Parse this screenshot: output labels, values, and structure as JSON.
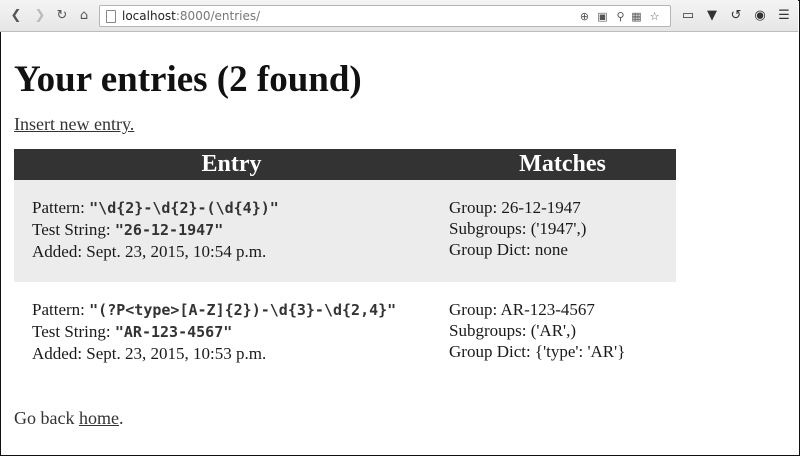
{
  "browser": {
    "url_host": "localhost",
    "url_rest": ":8000/entries/"
  },
  "page": {
    "title": "Your entries (2 found)",
    "insert_link": "Insert new entry.",
    "table_headers": {
      "entry": "Entry",
      "matches": "Matches"
    },
    "entries": [
      {
        "pattern_label": "Pattern: ",
        "pattern": "\"\\d{2}-\\d{2}-(\\d{4})\"",
        "test_label": "Test String: ",
        "test_string": "\"26-12-1947\"",
        "added": "Added: Sept. 23, 2015, 10:54 p.m.",
        "group": "Group: 26-12-1947",
        "subgroups": "Subgroups: ('1947',)",
        "group_dict": "Group Dict: none"
      },
      {
        "pattern_label": "Pattern: ",
        "pattern": "\"(?P<type>[A-Z]{2})-\\d{3}-\\d{2,4}\"",
        "test_label": "Test String: ",
        "test_string": "\"AR-123-4567\"",
        "added": "Added: Sept. 23, 2015, 10:53 p.m.",
        "group": "Group: AR-123-4567",
        "subgroups": "Subgroups: ('AR',)",
        "group_dict": "Group Dict: {'type': 'AR'}"
      }
    ],
    "footer_prefix": "Go back ",
    "footer_link": "home",
    "footer_suffix": "."
  },
  "colors": {
    "header_bg": "#333333",
    "alt_row_bg": "#ececec"
  }
}
